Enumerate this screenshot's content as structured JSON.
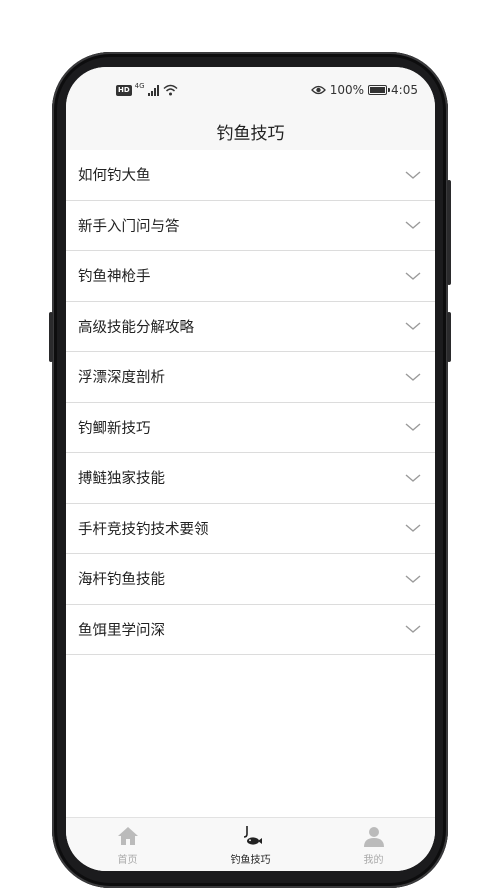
{
  "status_bar": {
    "hd_label": "HD",
    "network_label": "4G",
    "battery_text": "100%",
    "battery_level": 1.0,
    "time": "4:05"
  },
  "header": {
    "title": "钓鱼技巧"
  },
  "list": {
    "items": [
      {
        "label": "如何钓大鱼",
        "icon": "chevron-down-icon"
      },
      {
        "label": "新手入门问与答",
        "icon": "chevron-down-icon"
      },
      {
        "label": "钓鱼神枪手",
        "icon": "chevron-down-icon"
      },
      {
        "label": "高级技能分解攻略",
        "icon": "chevron-down-icon"
      },
      {
        "label": "浮漂深度剖析",
        "icon": "chevron-down-icon"
      },
      {
        "label": "钓鲫新技巧",
        "icon": "chevron-down-icon"
      },
      {
        "label": "搏鲢独家技能",
        "icon": "chevron-down-icon"
      },
      {
        "label": "手杆竞技钓技术要领",
        "icon": "chevron-down-icon"
      },
      {
        "label": "海杆钓鱼技能",
        "icon": "chevron-down-icon"
      },
      {
        "label": "鱼饵里学问深",
        "icon": "chevron-down-icon"
      }
    ]
  },
  "tab_bar": {
    "tabs": [
      {
        "label": "首页",
        "icon": "home-icon",
        "active": false
      },
      {
        "label": "钓鱼技巧",
        "icon": "fishing-icon",
        "active": true
      },
      {
        "label": "我的",
        "icon": "user-icon",
        "active": false
      }
    ]
  },
  "colors": {
    "header_bg": "#f7f7f7",
    "text": "#222222",
    "divider": "#dcdcdc",
    "tab_inactive": "#aaaaaa",
    "tab_active": "#222222",
    "phone_frame": "#1b1b1d"
  }
}
